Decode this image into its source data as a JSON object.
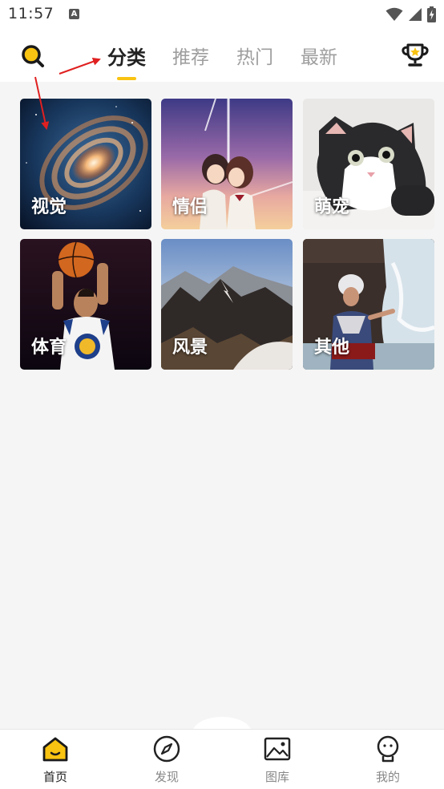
{
  "status_bar": {
    "time": "11:57",
    "notification_icon": "a-icon",
    "icons": [
      "wifi-icon",
      "signal-icon",
      "battery-charging-icon"
    ]
  },
  "header": {
    "search_icon": "search-icon",
    "trophy_icon": "trophy-icon",
    "tabs": [
      {
        "label": "分类",
        "active": true
      },
      {
        "label": "推荐",
        "active": false
      },
      {
        "label": "热门",
        "active": false
      },
      {
        "label": "最新",
        "active": false
      }
    ]
  },
  "categories": [
    {
      "label": "视觉",
      "thumbnail": "galaxy"
    },
    {
      "label": "情侣",
      "thumbnail": "anime-couple"
    },
    {
      "label": "萌宠",
      "thumbnail": "kitten"
    },
    {
      "label": "体育",
      "thumbnail": "basketball-player"
    },
    {
      "label": "风景",
      "thumbnail": "mountains"
    },
    {
      "label": "其他",
      "thumbnail": "waterfall-portrait"
    }
  ],
  "bottom_nav": [
    {
      "label": "首页",
      "icon": "home-icon",
      "active": true
    },
    {
      "label": "发现",
      "icon": "compass-icon",
      "active": false
    },
    {
      "label": "图库",
      "icon": "image-gallery-icon",
      "active": false
    },
    {
      "label": "我的",
      "icon": "profile-icon",
      "active": false
    }
  ],
  "colors": {
    "accent": "#f9c311",
    "background": "#f5f5f5",
    "annotation_arrow": "#e02020"
  }
}
